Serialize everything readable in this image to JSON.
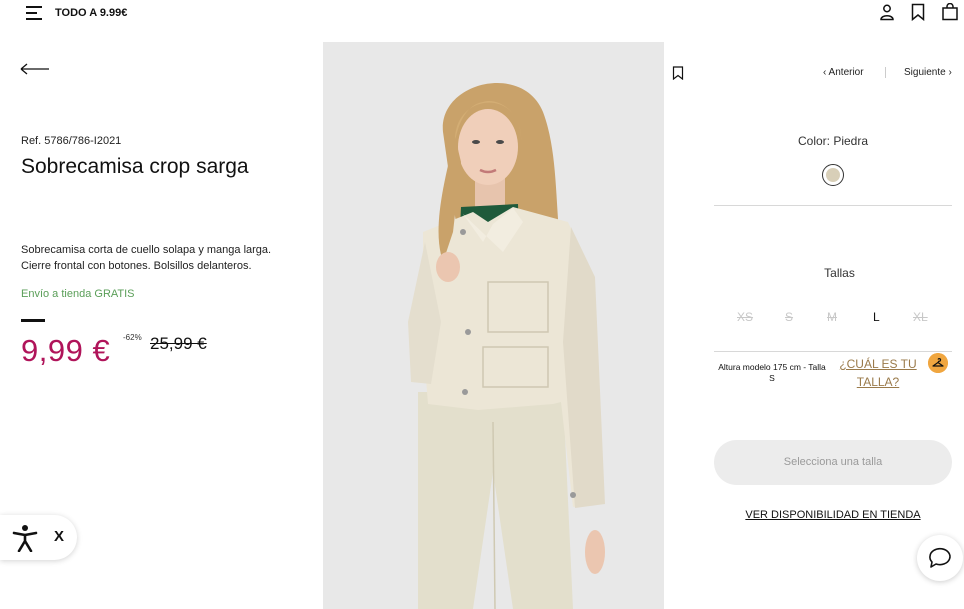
{
  "header": {
    "promo": "TODO A 9.99€",
    "icons": [
      "menu-icon",
      "user-icon",
      "bookmark-icon",
      "bag-icon"
    ]
  },
  "product": {
    "ref": "Ref. 5786/786-I2021",
    "title": "Sobrecamisa crop sarga",
    "description": "Sobrecamisa corta de cuello solapa y manga larga. Cierre frontal con botones. Bolsillos delanteros.",
    "shipping": "Envío a tienda GRATIS",
    "price_now": "9,99 €",
    "discount": "-62%",
    "price_old": "25,99 €",
    "price_color": "#b0145a"
  },
  "nav": {
    "prev": "‹ Anterior",
    "next": "Siguiente ›"
  },
  "color": {
    "label": "Color: Piedra",
    "swatch": "#d8cfb8"
  },
  "sizes": {
    "label": "Tallas",
    "items": [
      {
        "label": "XS",
        "available": false
      },
      {
        "label": "S",
        "available": false
      },
      {
        "label": "M",
        "available": false
      },
      {
        "label": "L",
        "available": true
      },
      {
        "label": "XL",
        "available": false
      }
    ]
  },
  "fit": {
    "model_info": "Altura modelo 175 cm - Talla S",
    "guide_link": "¿CUÁL ES TU TALLA?"
  },
  "actions": {
    "select_size": "Selecciona una talla",
    "store_availability": "VER DISPONIBILIDAD EN TIENDA"
  },
  "accessibility": {
    "close": "X"
  }
}
